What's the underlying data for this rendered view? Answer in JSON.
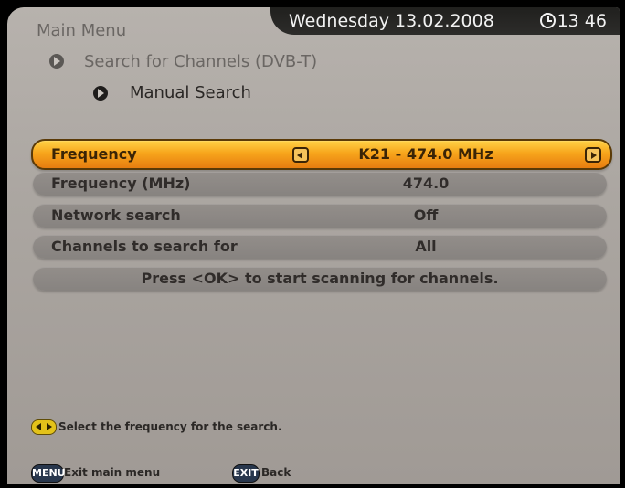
{
  "header": {
    "title": "Main Menu",
    "date": "Wednesday 13.02.2008",
    "time": "13 46"
  },
  "breadcrumb": {
    "level1": "Search for Channels (DVB-T)",
    "level2": "Manual Search"
  },
  "rows": [
    {
      "label": "Frequency",
      "value": "K21 - 474.0 MHz"
    },
    {
      "label": "Frequency (MHz)",
      "value": "474.0"
    },
    {
      "label": "Network search",
      "value": "Off"
    },
    {
      "label": "Channels to search for",
      "value": "All"
    }
  ],
  "action": {
    "text": "Press <OK> to start scanning for channels."
  },
  "hint": {
    "text": "Select the frequency for the search."
  },
  "footer": {
    "menu_key": "MENU",
    "menu_label": "Exit main menu",
    "exit_key": "EXIT",
    "exit_label": "Back"
  },
  "colors": {
    "accent": "#f7a51b",
    "background": "#aba6a1",
    "row": "#8d8985",
    "topbar": "#252422"
  },
  "icons": {
    "breadcrumb": "circle-arrow-icon",
    "left": "left-arrow-icon",
    "right": "right-arrow-icon",
    "clock": "clock-icon",
    "hint": "left-right-key-icon"
  }
}
